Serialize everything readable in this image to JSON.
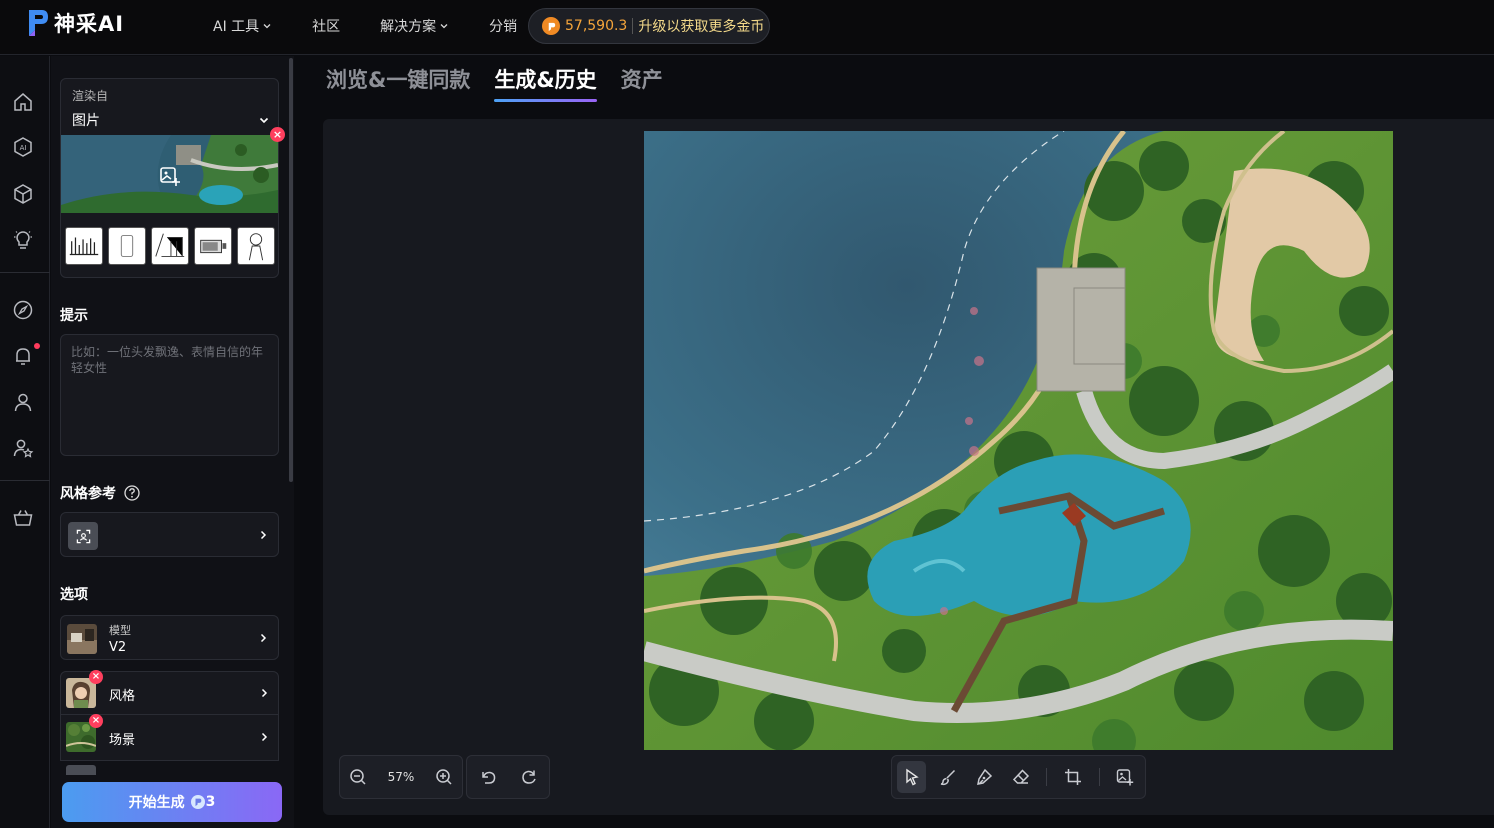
{
  "brand": {
    "name": "神采AI"
  },
  "nav": {
    "items": [
      {
        "label": "AI 工具",
        "dropdown": true
      },
      {
        "label": "社区",
        "dropdown": false
      },
      {
        "label": "解决方案",
        "dropdown": true
      },
      {
        "label": "分销",
        "dropdown": false
      }
    ],
    "coins": {
      "value": "57,590.3",
      "upgrade_label": "升级以获取更多金币"
    }
  },
  "rail": {
    "icons": [
      "home-icon",
      "ai-icon",
      "cube-icon",
      "bulb-icon",
      "compass-icon",
      "bell-icon",
      "user-icon",
      "user-star-icon",
      "basket-icon"
    ],
    "notification_dot": true
  },
  "panel": {
    "render_from": {
      "label": "渲染自",
      "value": "图片"
    },
    "prompt": {
      "title": "提示",
      "placeholder": "比如：一位头发飘逸、表情自信的年轻女性",
      "value": ""
    },
    "style_ref": {
      "title": "风格参考"
    },
    "options": {
      "title": "选项",
      "model": {
        "label": "模型",
        "value": "V2"
      },
      "style": {
        "label": "风格"
      },
      "scene": {
        "label": "场景"
      }
    },
    "generate": {
      "label": "开始生成",
      "cost": "3"
    }
  },
  "tabs": [
    {
      "label": "浏览&一键同款",
      "active": false
    },
    {
      "label": "生成&历史",
      "active": true
    },
    {
      "label": "资产",
      "active": false
    }
  ],
  "canvas": {
    "zoom": "57%"
  },
  "colors": {
    "accent_start": "#4b9cf0",
    "accent_end": "#8a68f5",
    "coin": "#f5a53b",
    "close": "#ff3f5e"
  }
}
